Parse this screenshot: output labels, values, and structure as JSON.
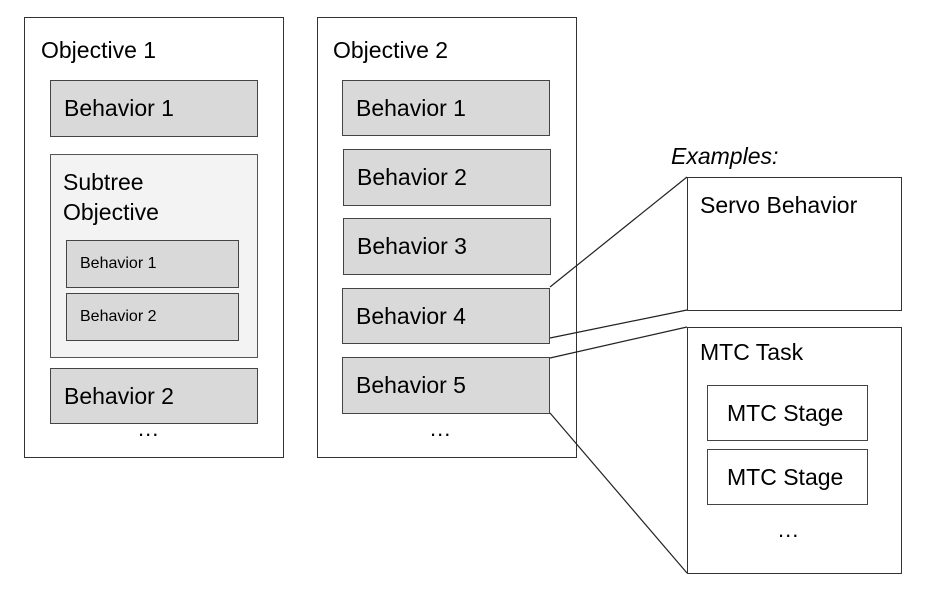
{
  "objective1": {
    "title": "Objective 1",
    "behavior_1": "Behavior 1",
    "subtree": {
      "title_line1": "Subtree",
      "title_line2": "Objective",
      "behaviors": [
        "Behavior 1",
        "Behavior 2"
      ]
    },
    "behavior_2": "Behavior 2",
    "ellipsis": "..."
  },
  "objective2": {
    "title": "Objective 2",
    "behaviors": [
      "Behavior 1",
      "Behavior 2",
      "Behavior 3",
      "Behavior 4",
      "Behavior 5"
    ],
    "ellipsis": "..."
  },
  "examples": {
    "heading": "Examples:",
    "servo": {
      "title": "Servo Behavior"
    },
    "mtc": {
      "title": "MTC Task",
      "stages": [
        "MTC Stage",
        "MTC Stage"
      ],
      "ellipsis": "..."
    }
  }
}
